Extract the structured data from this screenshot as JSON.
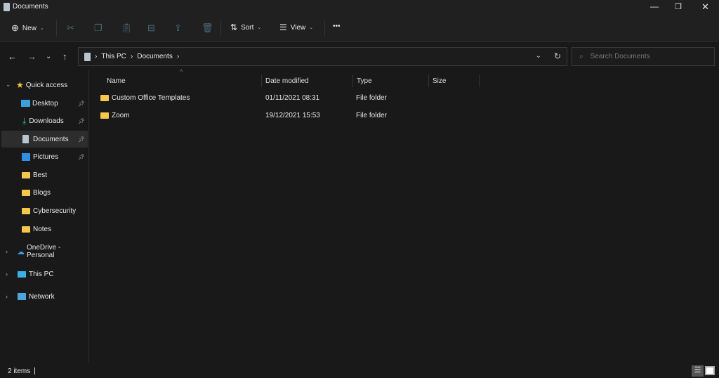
{
  "window": {
    "title": "Documents"
  },
  "toolbar": {
    "new_label": "New",
    "sort_label": "Sort",
    "view_label": "View",
    "more": "•••"
  },
  "address": {
    "crumbs": [
      "This PC",
      "Documents"
    ],
    "search_placeholder": "Search Documents"
  },
  "sidebar": {
    "quick_access": "Quick access",
    "items": [
      {
        "label": "Desktop",
        "pinned": true
      },
      {
        "label": "Downloads",
        "pinned": true
      },
      {
        "label": "Documents",
        "pinned": true
      },
      {
        "label": "Pictures",
        "pinned": true
      },
      {
        "label": "Best"
      },
      {
        "label": "Blogs"
      },
      {
        "label": "Cybersecurity"
      },
      {
        "label": "Notes"
      }
    ],
    "onedrive": "OneDrive - Personal",
    "thispc": "This PC",
    "network": "Network"
  },
  "columns": {
    "name": "Name",
    "date": "Date modified",
    "type": "Type",
    "size": "Size"
  },
  "files": [
    {
      "name": "Custom Office Templates",
      "date": "01/11/2021 08:31",
      "type": "File folder"
    },
    {
      "name": "Zoom",
      "date": "19/12/2021 15:53",
      "type": "File folder"
    }
  ],
  "status": {
    "count": "2 items"
  }
}
